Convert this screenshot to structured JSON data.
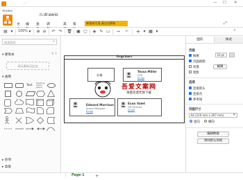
{
  "window": {
    "title": "...",
    "controls": {
      "minimize": "—",
      "maximize": "☐",
      "close": "✕"
    }
  },
  "app": {
    "name": "drawio",
    "doc_name": "n.drawio"
  },
  "menu": [
    "文件",
    "编辑",
    "查看",
    "调整图形",
    "其它",
    "帮助"
  ],
  "update_banner": "新版本可用,请点击更新",
  "toolbar": {
    "zoom": "100%"
  },
  "left": {
    "search_placeholder": "搜索图形",
    "scratchpad": "便笺本",
    "drop_hint": "把元素拖至此处",
    "general": "通用",
    "misc": "杂项",
    "advanced": "高级",
    "more_shapes": "+ 更多图形..."
  },
  "diagram": {
    "container_title": "Orgchart",
    "top_box": "头像",
    "people": [
      {
        "name": "Tessa Miller",
        "role": "CFO",
        "email": "Email"
      },
      {
        "name": "Edward Morrison",
        "role": "Brand Manager",
        "email": "Email"
      },
      {
        "name": "Evan Valet",
        "role": "HR Director",
        "email": "Email"
      }
    ]
  },
  "right": {
    "tabs": [
      "图形",
      "样式"
    ],
    "section_page": "页面",
    "grid": "网格",
    "grid_value": "10 pt",
    "page_view": "页面视图",
    "background": "背景",
    "shadow": "阴影",
    "edit_btn": "编辑",
    "options": "选项",
    "connection_arrows": "连接箭头",
    "connection_points": "连接点",
    "guides": "参考线",
    "paper_size": "页面尺寸",
    "paper_value": "A4 (210 mm x 297 mm)",
    "portrait": "竖向",
    "landscape": "横向",
    "edit_data": "编辑数据",
    "clear_default_style": "清除默认风格"
  },
  "status": {
    "page": "Page-1",
    "add": "+"
  },
  "watermark": {
    "main": "吾爱文案网",
    "sub": "海量资源无限下载"
  }
}
